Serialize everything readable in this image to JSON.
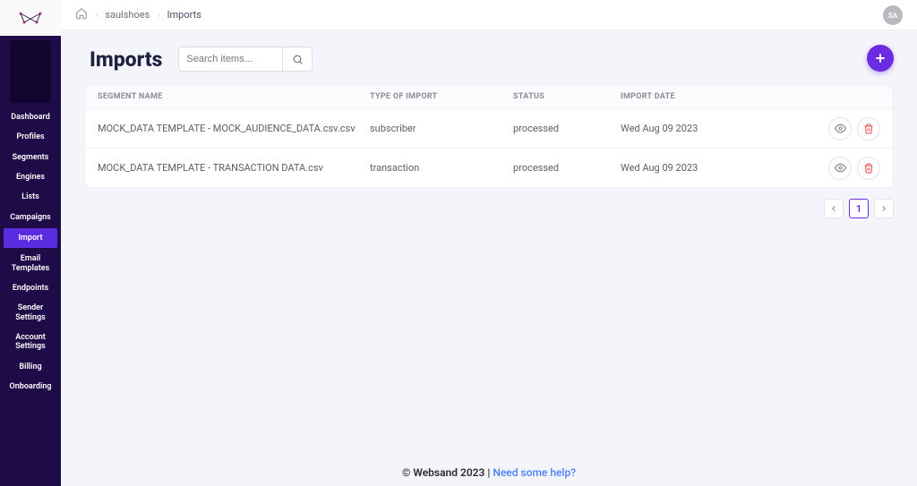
{
  "sidebar": {
    "items": [
      {
        "label": "Dashboard"
      },
      {
        "label": "Profiles"
      },
      {
        "label": "Segments"
      },
      {
        "label": "Engines"
      },
      {
        "label": "Lists"
      },
      {
        "label": "Campaigns"
      },
      {
        "label": "Import"
      },
      {
        "label": "Email Templates"
      },
      {
        "label": "Endpoints"
      },
      {
        "label": "Sender Settings"
      },
      {
        "label": "Account Settings"
      },
      {
        "label": "Billing"
      },
      {
        "label": "Onboarding"
      }
    ],
    "active_index": 6
  },
  "breadcrumb": {
    "items": [
      "saulshoes",
      "Imports"
    ]
  },
  "avatar_initials": "SA",
  "page_title": "Imports",
  "search_placeholder": "Search items...",
  "table": {
    "headers": {
      "name": "SEGMENT NAME",
      "type": "TYPE OF IMPORT",
      "status": "STATUS",
      "date": "IMPORT DATE"
    },
    "rows": [
      {
        "name": "MOCK_DATA TEMPLATE - MOCK_AUDIENCE_DATA.csv.csv",
        "type": "subscriber",
        "status": "processed",
        "date": "Wed Aug 09 2023"
      },
      {
        "name": "MOCK_DATA TEMPLATE - TRANSACTION DATA.csv",
        "type": "transaction",
        "status": "processed",
        "date": "Wed Aug 09 2023"
      }
    ]
  },
  "pagination": {
    "current": "1"
  },
  "footer": {
    "copyright": "© Websand 2023 | ",
    "help_link": "Need some help?"
  }
}
